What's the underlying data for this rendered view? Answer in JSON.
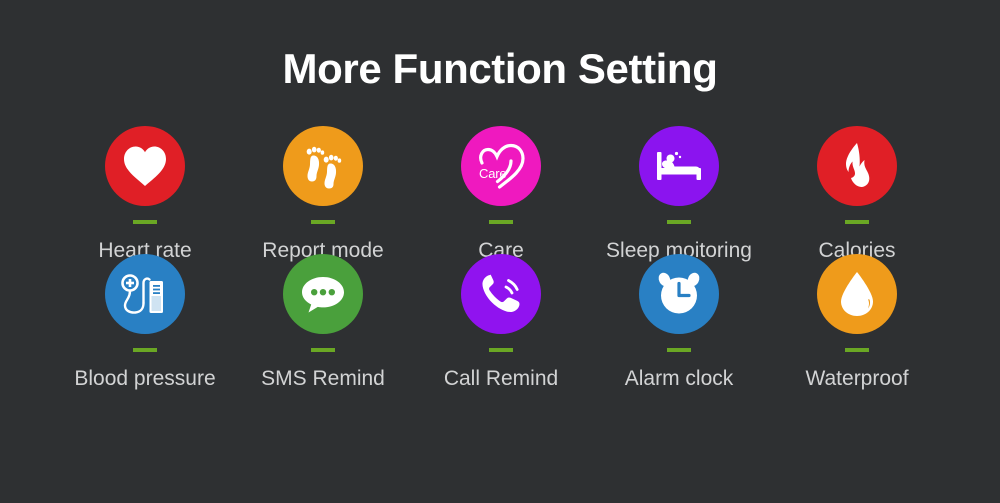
{
  "page": {
    "title": "More Function Setting",
    "background_color": "#2e3032",
    "title_color": "#ffffff",
    "label_color": "#d2d3d4",
    "divider_color": "#6aa724"
  },
  "features": [
    {
      "label": "Heart rate",
      "icon": "heart-icon",
      "circle_color": "#e01f26",
      "icon_color": "#ffffff"
    },
    {
      "label": "Report mode",
      "icon": "footprints-icon",
      "circle_color": "#ef9b1b",
      "icon_color": "#ffffff"
    },
    {
      "label": "Care",
      "icon": "care-heart-icon",
      "icon_text": "Care",
      "circle_color": "#ef19bf",
      "icon_color": "#ffffff"
    },
    {
      "label": "Sleep moitoring",
      "icon": "bed-sleep-icon",
      "circle_color": "#8b14ef",
      "icon_color": "#ffffff"
    },
    {
      "label": "Calories",
      "icon": "flame-icon",
      "circle_color": "#e01f26",
      "icon_color": "#ffffff"
    },
    {
      "label": "Blood pressure",
      "icon": "blood-pressure-monitor-icon",
      "circle_color": "#2980c4",
      "icon_color": "#ffffff"
    },
    {
      "label": "SMS Remind",
      "icon": "chat-bubble-icon",
      "circle_color": "#4aa03c",
      "icon_color": "#ffffff"
    },
    {
      "label": "Call Remind",
      "icon": "phone-ringing-icon",
      "circle_color": "#9013ef",
      "icon_color": "#ffffff"
    },
    {
      "label": "Alarm clock",
      "icon": "alarm-clock-icon",
      "circle_color": "#2980c4",
      "icon_color": "#ffffff"
    },
    {
      "label": "Waterproof",
      "icon": "water-drop-icon",
      "circle_color": "#ef9b1b",
      "icon_color": "#ffffff"
    }
  ]
}
